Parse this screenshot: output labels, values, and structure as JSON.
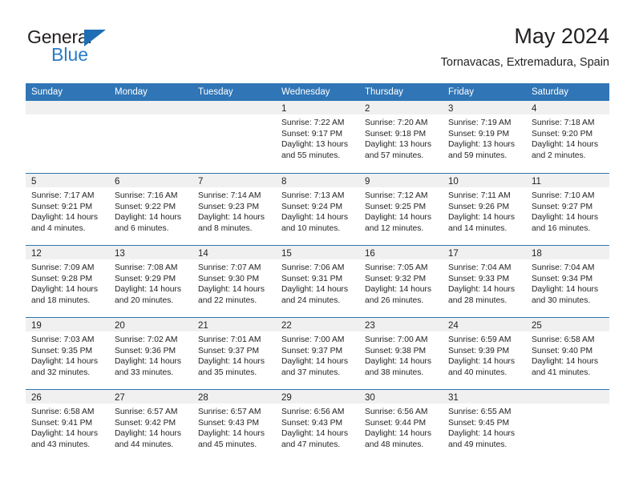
{
  "brand": {
    "name_top": "General",
    "name_bottom": "Blue",
    "accent_color": "#2a7cc7",
    "triangle_color": "#1f6db5",
    "triangle_icon": "brand-triangle-icon"
  },
  "header": {
    "title": "May 2024",
    "subtitle": "Tornavacas, Extremadura, Spain"
  },
  "colors": {
    "header_row_bg": "#3075b6",
    "header_row_text": "#ffffff",
    "daynum_strip_bg": "#f0f0f0",
    "cell_bg": "#ffffff",
    "text": "#231f20",
    "week_separator": "#3075b6"
  },
  "weekday_headers": [
    "Sunday",
    "Monday",
    "Tuesday",
    "Wednesday",
    "Thursday",
    "Friday",
    "Saturday"
  ],
  "weeks": [
    [
      {
        "day": "",
        "lines": []
      },
      {
        "day": "",
        "lines": []
      },
      {
        "day": "",
        "lines": []
      },
      {
        "day": "1",
        "lines": [
          "Sunrise: 7:22 AM",
          "Sunset: 9:17 PM",
          "Daylight: 13 hours",
          "and 55 minutes."
        ]
      },
      {
        "day": "2",
        "lines": [
          "Sunrise: 7:20 AM",
          "Sunset: 9:18 PM",
          "Daylight: 13 hours",
          "and 57 minutes."
        ]
      },
      {
        "day": "3",
        "lines": [
          "Sunrise: 7:19 AM",
          "Sunset: 9:19 PM",
          "Daylight: 13 hours",
          "and 59 minutes."
        ]
      },
      {
        "day": "4",
        "lines": [
          "Sunrise: 7:18 AM",
          "Sunset: 9:20 PM",
          "Daylight: 14 hours",
          "and 2 minutes."
        ]
      }
    ],
    [
      {
        "day": "5",
        "lines": [
          "Sunrise: 7:17 AM",
          "Sunset: 9:21 PM",
          "Daylight: 14 hours",
          "and 4 minutes."
        ]
      },
      {
        "day": "6",
        "lines": [
          "Sunrise: 7:16 AM",
          "Sunset: 9:22 PM",
          "Daylight: 14 hours",
          "and 6 minutes."
        ]
      },
      {
        "day": "7",
        "lines": [
          "Sunrise: 7:14 AM",
          "Sunset: 9:23 PM",
          "Daylight: 14 hours",
          "and 8 minutes."
        ]
      },
      {
        "day": "8",
        "lines": [
          "Sunrise: 7:13 AM",
          "Sunset: 9:24 PM",
          "Daylight: 14 hours",
          "and 10 minutes."
        ]
      },
      {
        "day": "9",
        "lines": [
          "Sunrise: 7:12 AM",
          "Sunset: 9:25 PM",
          "Daylight: 14 hours",
          "and 12 minutes."
        ]
      },
      {
        "day": "10",
        "lines": [
          "Sunrise: 7:11 AM",
          "Sunset: 9:26 PM",
          "Daylight: 14 hours",
          "and 14 minutes."
        ]
      },
      {
        "day": "11",
        "lines": [
          "Sunrise: 7:10 AM",
          "Sunset: 9:27 PM",
          "Daylight: 14 hours",
          "and 16 minutes."
        ]
      }
    ],
    [
      {
        "day": "12",
        "lines": [
          "Sunrise: 7:09 AM",
          "Sunset: 9:28 PM",
          "Daylight: 14 hours",
          "and 18 minutes."
        ]
      },
      {
        "day": "13",
        "lines": [
          "Sunrise: 7:08 AM",
          "Sunset: 9:29 PM",
          "Daylight: 14 hours",
          "and 20 minutes."
        ]
      },
      {
        "day": "14",
        "lines": [
          "Sunrise: 7:07 AM",
          "Sunset: 9:30 PM",
          "Daylight: 14 hours",
          "and 22 minutes."
        ]
      },
      {
        "day": "15",
        "lines": [
          "Sunrise: 7:06 AM",
          "Sunset: 9:31 PM",
          "Daylight: 14 hours",
          "and 24 minutes."
        ]
      },
      {
        "day": "16",
        "lines": [
          "Sunrise: 7:05 AM",
          "Sunset: 9:32 PM",
          "Daylight: 14 hours",
          "and 26 minutes."
        ]
      },
      {
        "day": "17",
        "lines": [
          "Sunrise: 7:04 AM",
          "Sunset: 9:33 PM",
          "Daylight: 14 hours",
          "and 28 minutes."
        ]
      },
      {
        "day": "18",
        "lines": [
          "Sunrise: 7:04 AM",
          "Sunset: 9:34 PM",
          "Daylight: 14 hours",
          "and 30 minutes."
        ]
      }
    ],
    [
      {
        "day": "19",
        "lines": [
          "Sunrise: 7:03 AM",
          "Sunset: 9:35 PM",
          "Daylight: 14 hours",
          "and 32 minutes."
        ]
      },
      {
        "day": "20",
        "lines": [
          "Sunrise: 7:02 AM",
          "Sunset: 9:36 PM",
          "Daylight: 14 hours",
          "and 33 minutes."
        ]
      },
      {
        "day": "21",
        "lines": [
          "Sunrise: 7:01 AM",
          "Sunset: 9:37 PM",
          "Daylight: 14 hours",
          "and 35 minutes."
        ]
      },
      {
        "day": "22",
        "lines": [
          "Sunrise: 7:00 AM",
          "Sunset: 9:37 PM",
          "Daylight: 14 hours",
          "and 37 minutes."
        ]
      },
      {
        "day": "23",
        "lines": [
          "Sunrise: 7:00 AM",
          "Sunset: 9:38 PM",
          "Daylight: 14 hours",
          "and 38 minutes."
        ]
      },
      {
        "day": "24",
        "lines": [
          "Sunrise: 6:59 AM",
          "Sunset: 9:39 PM",
          "Daylight: 14 hours",
          "and 40 minutes."
        ]
      },
      {
        "day": "25",
        "lines": [
          "Sunrise: 6:58 AM",
          "Sunset: 9:40 PM",
          "Daylight: 14 hours",
          "and 41 minutes."
        ]
      }
    ],
    [
      {
        "day": "26",
        "lines": [
          "Sunrise: 6:58 AM",
          "Sunset: 9:41 PM",
          "Daylight: 14 hours",
          "and 43 minutes."
        ]
      },
      {
        "day": "27",
        "lines": [
          "Sunrise: 6:57 AM",
          "Sunset: 9:42 PM",
          "Daylight: 14 hours",
          "and 44 minutes."
        ]
      },
      {
        "day": "28",
        "lines": [
          "Sunrise: 6:57 AM",
          "Sunset: 9:43 PM",
          "Daylight: 14 hours",
          "and 45 minutes."
        ]
      },
      {
        "day": "29",
        "lines": [
          "Sunrise: 6:56 AM",
          "Sunset: 9:43 PM",
          "Daylight: 14 hours",
          "and 47 minutes."
        ]
      },
      {
        "day": "30",
        "lines": [
          "Sunrise: 6:56 AM",
          "Sunset: 9:44 PM",
          "Daylight: 14 hours",
          "and 48 minutes."
        ]
      },
      {
        "day": "31",
        "lines": [
          "Sunrise: 6:55 AM",
          "Sunset: 9:45 PM",
          "Daylight: 14 hours",
          "and 49 minutes."
        ]
      },
      {
        "day": "",
        "lines": []
      }
    ]
  ]
}
